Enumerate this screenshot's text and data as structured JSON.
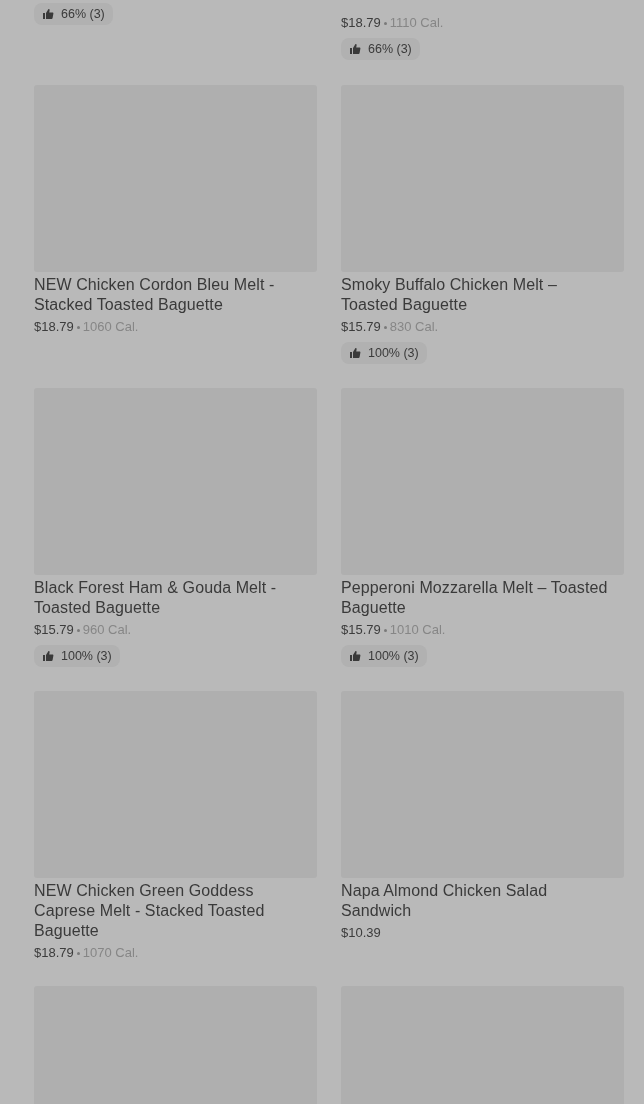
{
  "top_partial": [
    {
      "rating": "66% (3)"
    },
    {
      "price": "$18.79",
      "calories": "1110 Cal.",
      "rating": "66% (3)"
    }
  ],
  "items": [
    {
      "image": {
        "kind": "picture"
      },
      "title": "NEW Chicken Cordon Bleu Melt - Stacked Toasted Baguette",
      "price": "$18.79",
      "calories": "1060 Cal."
    },
    {
      "image": {
        "kind": "picture"
      },
      "title": "Smoky Buffalo Chicken Melt – Toasted Baguette",
      "price": "$15.79",
      "calories": "830 Cal.",
      "rating": "100% (3)"
    },
    {
      "image": {
        "kind": "picture"
      },
      "title": "Black Forest Ham & Gouda Melt - Toasted Baguette",
      "price": "$15.79",
      "calories": "960 Cal.",
      "rating": "100% (3)"
    },
    {
      "image": {
        "kind": "picture"
      },
      "title": "Pepperoni Mozzarella Melt – Toasted Baguette",
      "price": "$15.79",
      "calories": "1010 Cal.",
      "rating": "100% (3)"
    },
    {
      "image": {
        "kind": "picture"
      },
      "title": "NEW Chicken Green Goddess Caprese Melt - Stacked Toasted Baguette",
      "price": "$18.79",
      "calories": "1070 Cal."
    },
    {
      "image": {
        "kind": "picture"
      },
      "title": "Napa Almond Chicken Salad Sandwich",
      "price": "$10.39"
    },
    {
      "image": {
        "kind": "picture"
      }
    },
    {
      "image": {
        "kind": "picture"
      }
    }
  ]
}
